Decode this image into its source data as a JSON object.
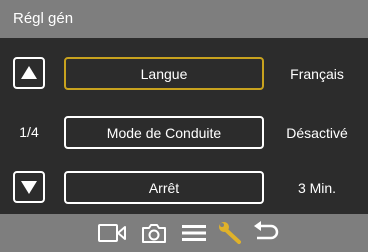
{
  "header": {
    "title": "Régl gén"
  },
  "navigation": {
    "page_indicator": "1/4",
    "up_icon": "arrow-up-icon",
    "down_icon": "arrow-down-icon"
  },
  "settings": [
    {
      "label": "Langue",
      "value": "Français",
      "selected": true
    },
    {
      "label": "Mode de Conduite",
      "value": "Désactivé",
      "selected": false
    },
    {
      "label": "Arrêt",
      "value": "3 Min.",
      "selected": false
    }
  ],
  "footer": {
    "icons": [
      "video-camera-icon",
      "photo-camera-icon",
      "menu-icon",
      "wrench-icon",
      "back-icon"
    ],
    "active_icon": "wrench-icon"
  },
  "colors": {
    "bar": "#7e7e7e",
    "background": "#2c2c2c",
    "selected_border": "#c8a21e",
    "active_icon": "#e0b22a"
  }
}
